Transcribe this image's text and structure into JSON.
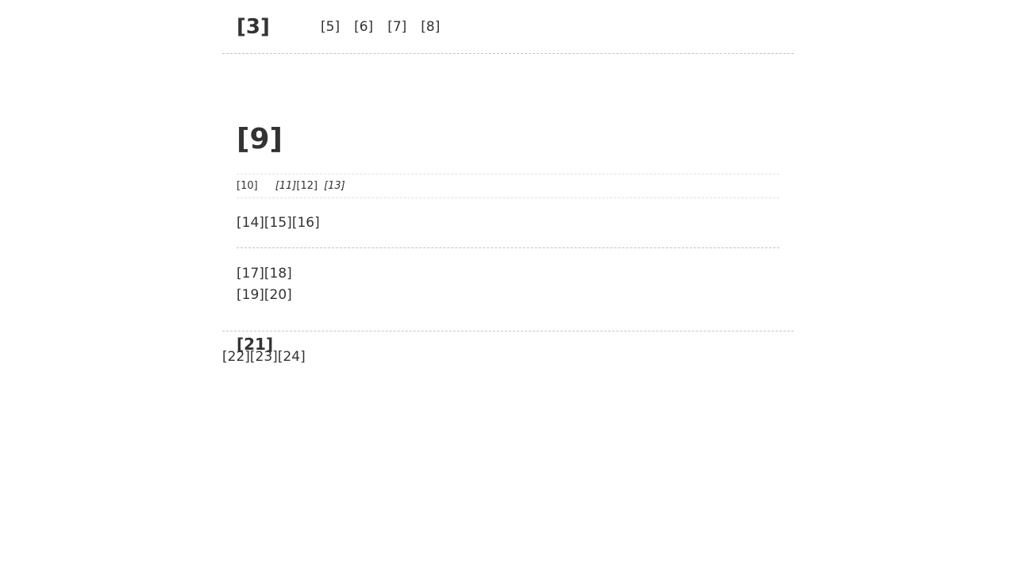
{
  "header": {
    "site_title": "[3]",
    "nav": [
      "[5]",
      "[6]",
      "[7]",
      "[8]"
    ]
  },
  "post": {
    "title": "[9]",
    "meta": {
      "date": "[10]",
      "part1": "[11]",
      "part2": "[12]",
      "part3": "[13]"
    },
    "excerpt": [
      "[14]",
      "[15]",
      "[16]"
    ],
    "body_lines": [
      [
        "[17]",
        "[18]"
      ],
      [
        "[19]",
        "[20]"
      ]
    ],
    "subheading": "[21]"
  },
  "footer": {
    "items": [
      "[22]",
      "[23]",
      "[24]"
    ]
  }
}
